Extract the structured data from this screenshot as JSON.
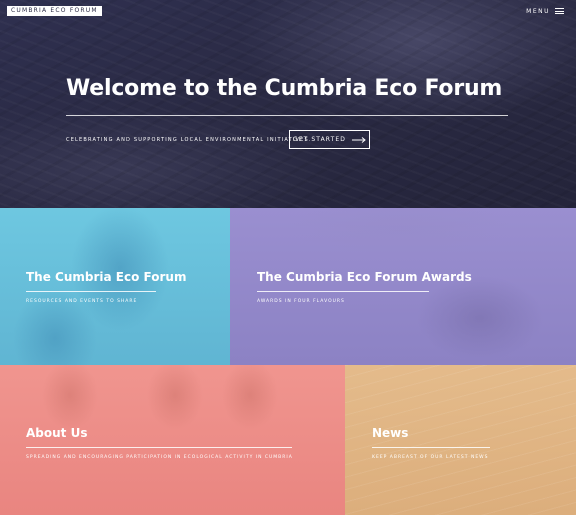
{
  "header": {
    "brand": "CUMBRIA ECO FORUM",
    "menu_label": "MENU",
    "menu_icon": "hamburger-icon"
  },
  "hero": {
    "title": "Welcome to the Cumbria Eco Forum",
    "subtitle": "CELEBRATING AND SUPPORTING LOCAL ENVIRONMENTAL INITIATIVES.",
    "cta_label": "GET STARTED",
    "cta_icon": "arrow-right-icon"
  },
  "tiles": [
    {
      "title": "The Cumbria Eco Forum",
      "subtitle": "RESOURCES AND EVENTS TO SHARE",
      "color": "#6cc4dc"
    },
    {
      "title": "The Cumbria Eco Forum Awards",
      "subtitle": "AWARDS IN FOUR FLAVOURS",
      "color": "#8f84c6"
    },
    {
      "title": "About Us",
      "subtitle": "SPREADING AND ENCOURAGING PARTICIPATION IN ECOLOGICAL ACTIVITY IN CUMBRIA",
      "color": "#ec8b86"
    },
    {
      "title": "News",
      "subtitle": "KEEP ABREAST OF OUR LATEST NEWS",
      "color": "#e1b685"
    }
  ]
}
